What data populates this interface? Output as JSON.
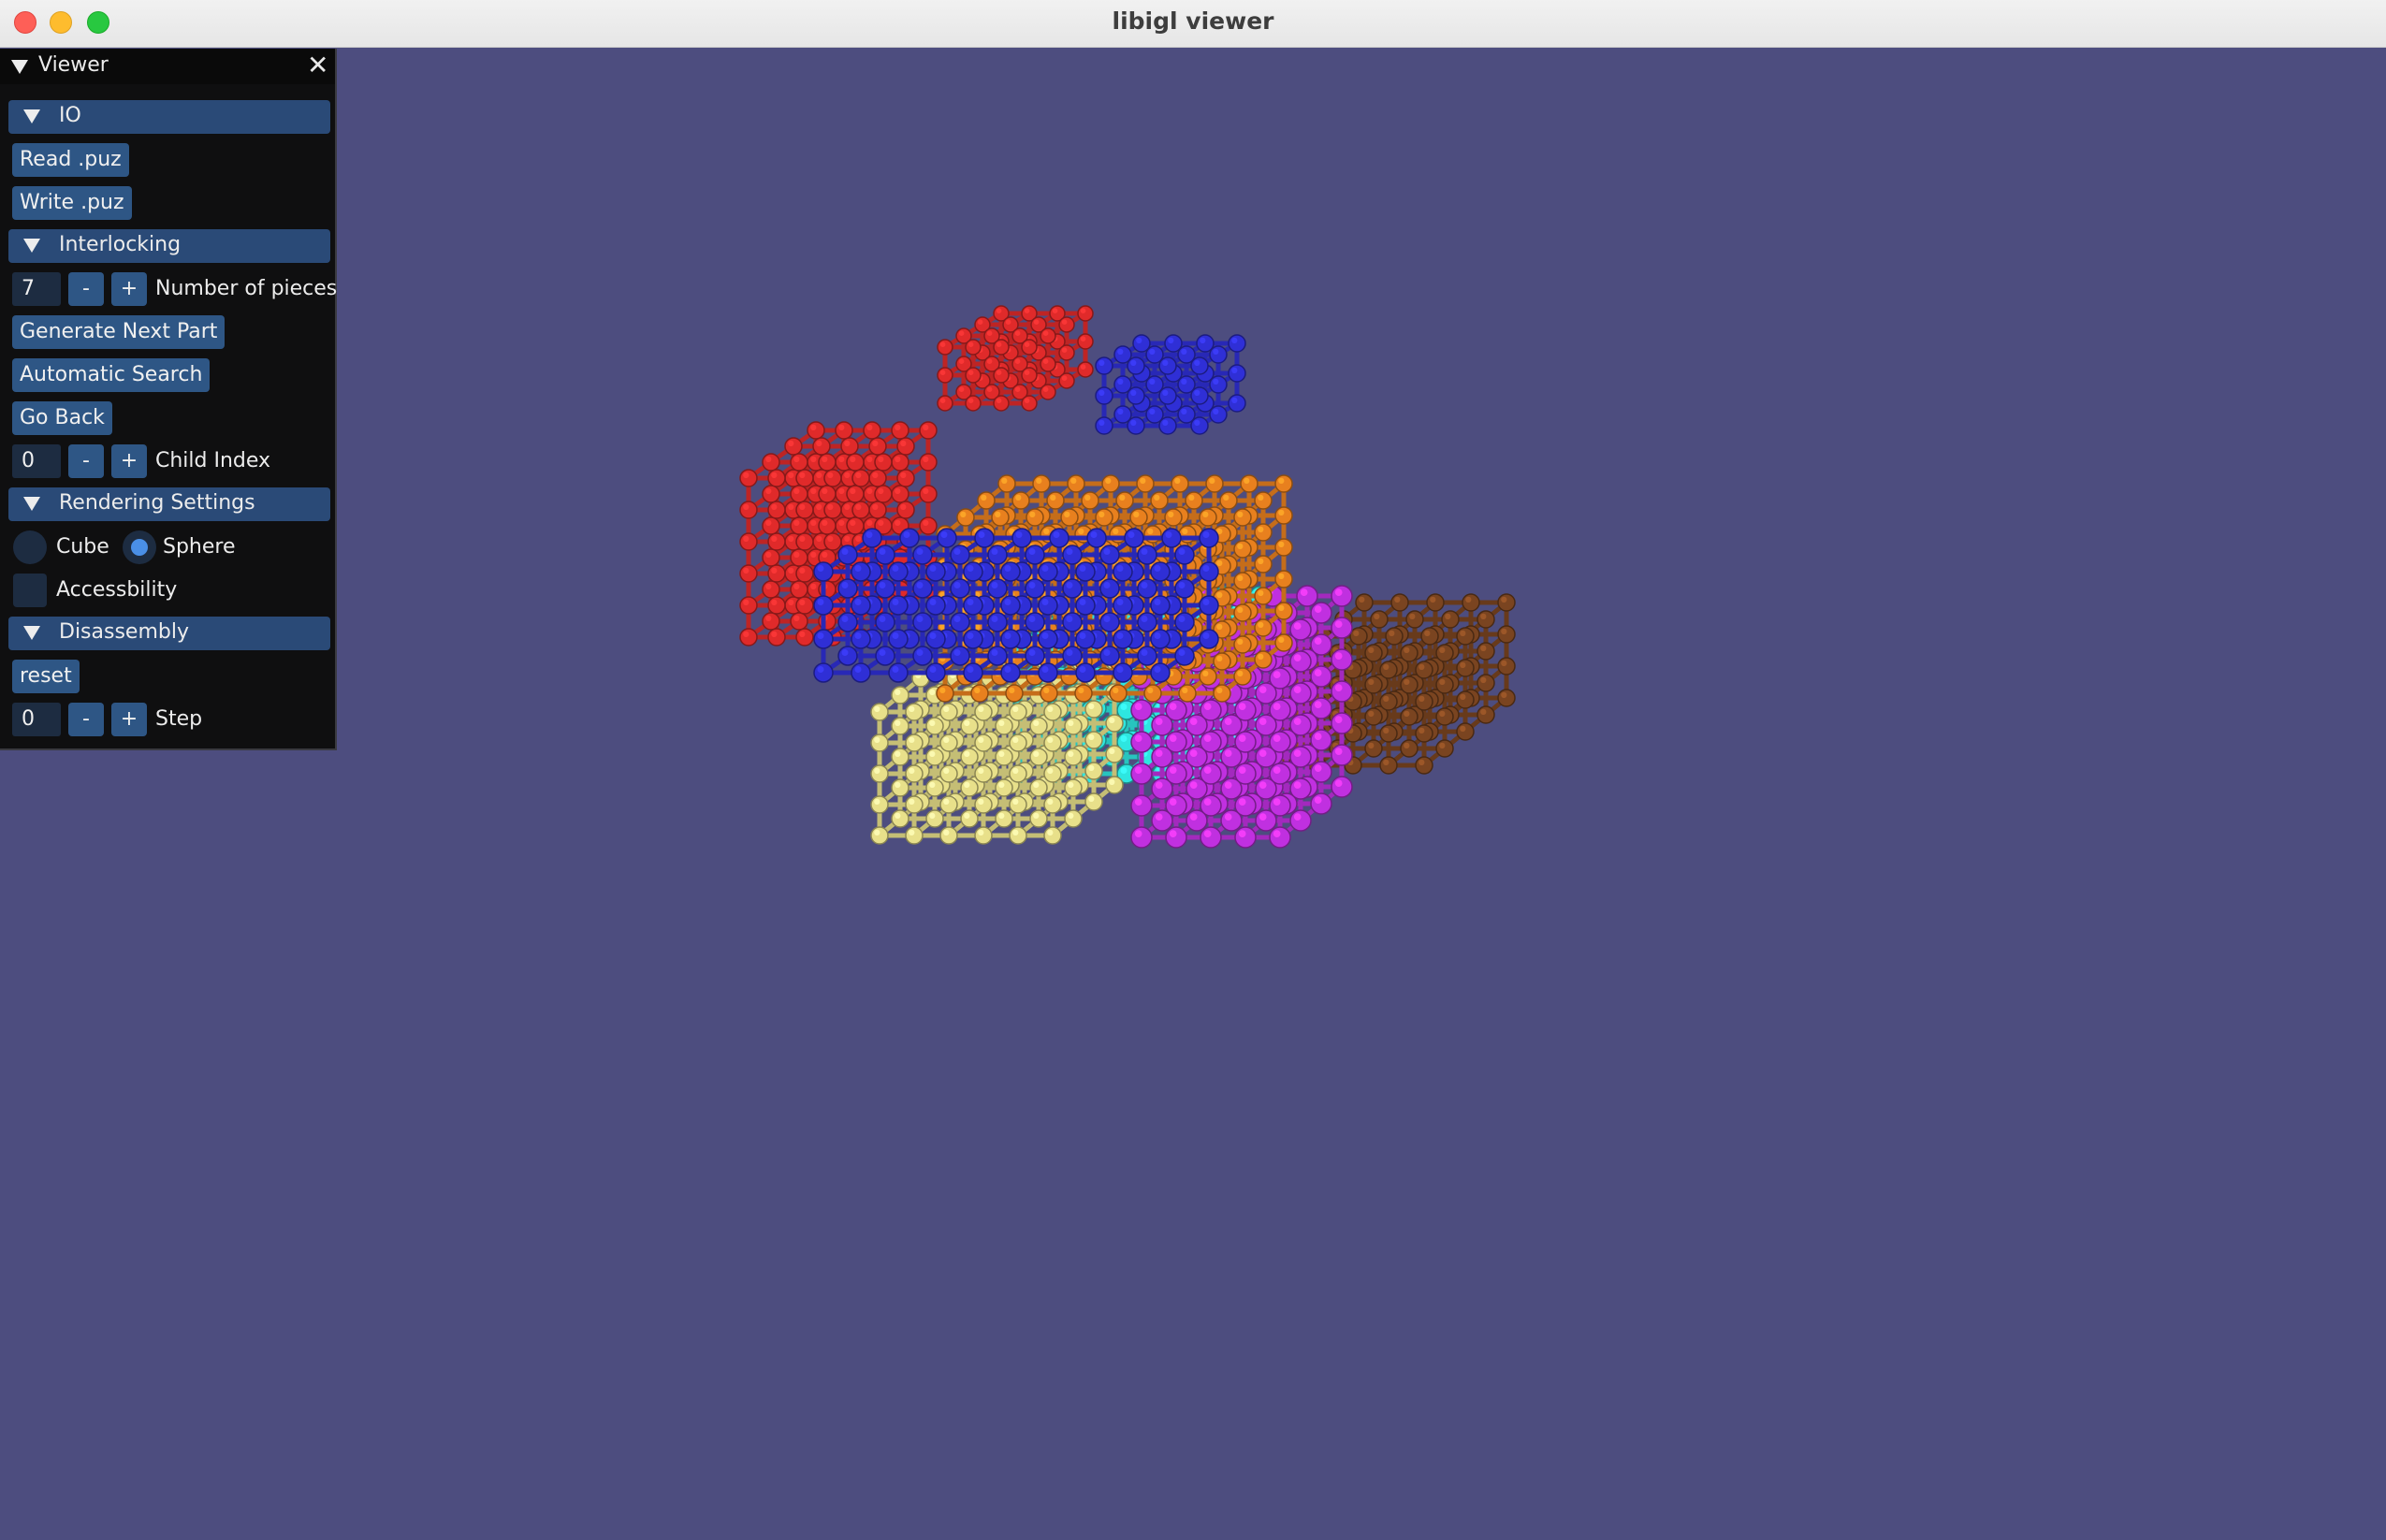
{
  "window": {
    "title": "libigl viewer"
  },
  "panel": {
    "title": "Viewer",
    "sections": {
      "io": {
        "label": "IO",
        "read_label": "Read .puz",
        "write_label": "Write .puz"
      },
      "interlocking": {
        "label": "Interlocking",
        "num_pieces_value": "7",
        "num_pieces_label": "Number of pieces",
        "generate_label": "Generate Next Part",
        "auto_search_label": "Automatic Search",
        "go_back_label": "Go Back",
        "child_index_value": "0",
        "child_index_label": "Child Index"
      },
      "rendering": {
        "label": "Rendering Settings",
        "cube_label": "Cube",
        "sphere_label": "Sphere",
        "selected_shape": "Sphere",
        "accessibility_label": "Accessbility",
        "accessibility_checked": false
      },
      "disassembly": {
        "label": "Disassembly",
        "reset_label": "reset",
        "step_value": "0",
        "step_label": "Step"
      }
    },
    "stepper": {
      "minus": "-",
      "plus": "+"
    }
  },
  "viewport": {
    "background": "#4d4d7f",
    "pieces": [
      {
        "name": "red",
        "color": "#e02a2a"
      },
      {
        "name": "blue-top",
        "color": "#2f2fd6"
      },
      {
        "name": "orange",
        "color": "#e8801e"
      },
      {
        "name": "blue",
        "color": "#2f2fd6"
      },
      {
        "name": "yellow",
        "color": "#e8e08a"
      },
      {
        "name": "cyan",
        "color": "#2ee6e0"
      },
      {
        "name": "magenta",
        "color": "#c030e0"
      },
      {
        "name": "brown",
        "color": "#7a4420"
      }
    ]
  }
}
